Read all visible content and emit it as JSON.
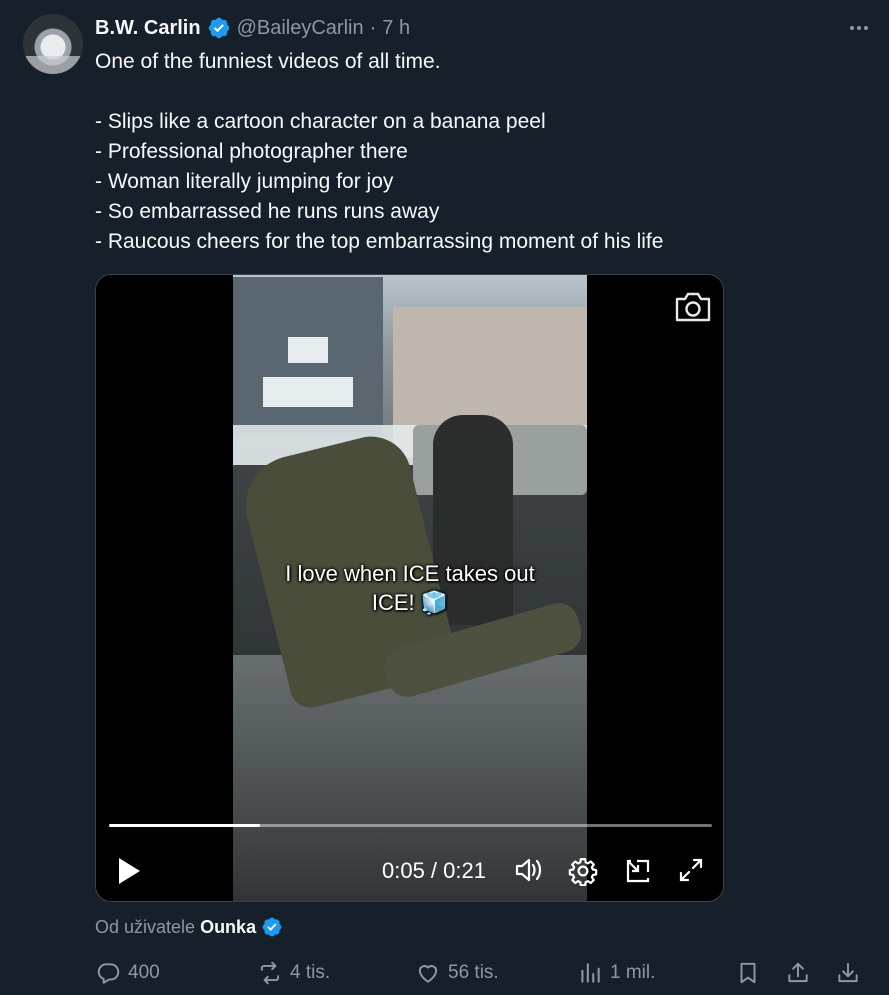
{
  "author": {
    "name": "B.W. Carlin",
    "handle": "@BaileyCarlin",
    "separator": "·",
    "time": "7 h"
  },
  "tweet": {
    "lines": [
      "One of the funniest videos of all time.",
      "",
      "- Slips like a cartoon character on a banana peel",
      "- Professional photographer there",
      "- Woman literally jumping for joy",
      "- So embarrassed he runs runs away",
      "- Raucous cheers for the top embarrassing moment of his life"
    ]
  },
  "video": {
    "caption_line1": "I love when ICE takes out",
    "caption_line2": "ICE! 🧊",
    "current_time": "0:05",
    "duration": "0:21",
    "time_display": "0:05 / 0:21",
    "progress_fraction": 0.25
  },
  "attribution": {
    "prefix": "Od uživatele",
    "source": "Ounka"
  },
  "actions": {
    "replies": "400",
    "reposts": "4 tis.",
    "likes": "56 tis.",
    "views": "1 mil."
  },
  "icons": {
    "verified": "verified-badge-icon",
    "more": "more-icon",
    "camera": "camera-icon",
    "play": "play-icon",
    "volume": "volume-icon",
    "settings": "gear-icon",
    "pip": "picture-in-picture-icon",
    "fullscreen": "fullscreen-icon",
    "reply": "reply-icon",
    "repost": "repost-icon",
    "like": "heart-icon",
    "views": "views-icon",
    "bookmark": "bookmark-icon",
    "share": "share-icon",
    "download": "download-icon"
  },
  "colors": {
    "background": "#15202b",
    "verified": "#1d9bf0",
    "secondary_text": "#8b98a5"
  }
}
